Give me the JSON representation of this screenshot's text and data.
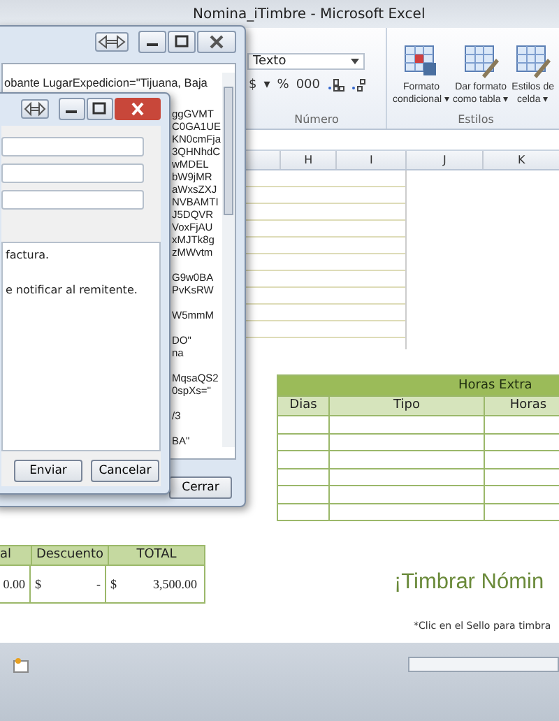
{
  "excel": {
    "title": "Nomina_iTimbre - Microsoft Excel",
    "number_format": "Texto",
    "number_buttons": [
      "$",
      "▾",
      "%",
      "000"
    ],
    "number_group": "Número",
    "style_buttons": [
      {
        "lines": [
          "Formato",
          "condicional ▾"
        ]
      },
      {
        "lines": [
          "Dar formato",
          "como tabla ▾"
        ]
      },
      {
        "lines": [
          "Estilos de",
          "celda ▾"
        ]
      }
    ],
    "styles_group": "Estilos",
    "columns": [
      "H",
      "I",
      "J",
      "K"
    ]
  },
  "overtime_table": {
    "title": "Horas Extra",
    "columns": [
      "Dias",
      "Tipo",
      "Horas"
    ]
  },
  "totals_table": {
    "columns": [
      "al",
      "Descuento",
      "TOTAL"
    ],
    "cells": [
      {
        "amount": "0.00"
      },
      {
        "currency": "$",
        "amount": "-"
      },
      {
        "currency": "$",
        "amount": "3,500.00"
      }
    ]
  },
  "stamp": {
    "title": "¡Timbrar Nómin",
    "note": "*Clic en el Sello para timbra"
  },
  "xml_window": {
    "first_line": "obante LugarExpedicion=\"Tijuana, Baja",
    "blocks": [
      [
        "ggGVMT",
        "C0GA1UE",
        "KN0cmFja",
        "3QHNhdC",
        "wMDEL",
        "bW9jMR",
        "aWxsZXJ",
        "NVBAMTI",
        "J5DQVR",
        "VoxFjAU",
        "xMJTk8g",
        "zMWvtm"
      ],
      [
        "G9w0BA",
        "PvKsRW"
      ],
      [
        "W5mmM"
      ],
      [
        "DO\"",
        "na"
      ],
      [
        "MqsaQS2",
        "0spXs=\""
      ],
      [
        "/3"
      ],
      [
        "BA\""
      ]
    ],
    "button": "Cerrar"
  },
  "dialog": {
    "message_lines": [
      "factura.",
      "e notificar al remitente."
    ],
    "buttons": [
      "Enviar",
      "Cancelar"
    ]
  }
}
